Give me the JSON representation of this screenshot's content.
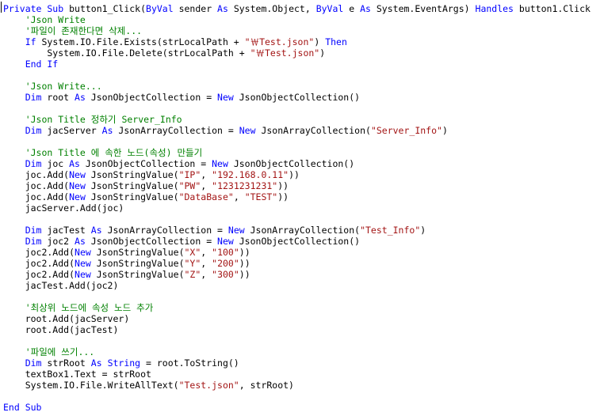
{
  "editor": {
    "colors": {
      "background": "#ffffff",
      "keyword": "#0000ff",
      "string": "#a31515",
      "comment": "#008000",
      "plain": "#000000"
    },
    "lines": [
      {
        "tokens": [
          [
            "kw",
            "Private Sub"
          ],
          [
            "plain",
            " button1_Click("
          ],
          [
            "kw",
            "ByVal"
          ],
          [
            "plain",
            " sender "
          ],
          [
            "kw",
            "As"
          ],
          [
            "plain",
            " System.Object, "
          ],
          [
            "kw",
            "ByVal"
          ],
          [
            "plain",
            " e "
          ],
          [
            "kw",
            "As"
          ],
          [
            "plain",
            " System.EventArgs) "
          ],
          [
            "kw",
            "Handles"
          ],
          [
            "plain",
            " button1.Click"
          ]
        ]
      },
      {
        "tokens": [
          [
            "cm",
            "    'Json Write"
          ]
        ]
      },
      {
        "tokens": [
          [
            "cm",
            "    '파일이 존재한다면 삭제..."
          ]
        ]
      },
      {
        "tokens": [
          [
            "kw",
            "    If"
          ],
          [
            "plain",
            " System.IO.File.Exists(strLocalPath + "
          ],
          [
            "str",
            "\"￦Test.json\""
          ],
          [
            "plain",
            ") "
          ],
          [
            "kw",
            "Then"
          ]
        ]
      },
      {
        "tokens": [
          [
            "plain",
            "        System.IO.File.Delete(strLocalPath + "
          ],
          [
            "str",
            "\"￦Test.json\""
          ],
          [
            "plain",
            ")"
          ]
        ]
      },
      {
        "tokens": [
          [
            "kw",
            "    End If"
          ]
        ]
      },
      {
        "tokens": []
      },
      {
        "tokens": [
          [
            "cm",
            "    'Json Write..."
          ]
        ]
      },
      {
        "tokens": [
          [
            "kw",
            "    Dim"
          ],
          [
            "plain",
            " root "
          ],
          [
            "kw",
            "As"
          ],
          [
            "plain",
            " JsonObjectCollection = "
          ],
          [
            "kw",
            "New"
          ],
          [
            "plain",
            " JsonObjectCollection()"
          ]
        ]
      },
      {
        "tokens": []
      },
      {
        "tokens": [
          [
            "cm",
            "    'Json Title 정하기 Server_Info"
          ]
        ]
      },
      {
        "tokens": [
          [
            "kw",
            "    Dim"
          ],
          [
            "plain",
            " jacServer "
          ],
          [
            "kw",
            "As"
          ],
          [
            "plain",
            " JsonArrayCollection = "
          ],
          [
            "kw",
            "New"
          ],
          [
            "plain",
            " JsonArrayCollection("
          ],
          [
            "str",
            "\"Server_Info\""
          ],
          [
            "plain",
            ")"
          ]
        ]
      },
      {
        "tokens": []
      },
      {
        "tokens": [
          [
            "cm",
            "    'Json Title 에 속한 노드(속성) 만들기"
          ]
        ]
      },
      {
        "tokens": [
          [
            "kw",
            "    Dim"
          ],
          [
            "plain",
            " joc "
          ],
          [
            "kw",
            "As"
          ],
          [
            "plain",
            " JsonObjectCollection = "
          ],
          [
            "kw",
            "New"
          ],
          [
            "plain",
            " JsonObjectCollection()"
          ]
        ]
      },
      {
        "tokens": [
          [
            "plain",
            "    joc.Add("
          ],
          [
            "kw",
            "New"
          ],
          [
            "plain",
            " JsonStringValue("
          ],
          [
            "str",
            "\"IP\""
          ],
          [
            "plain",
            ", "
          ],
          [
            "str",
            "\"192.168.0.11\""
          ],
          [
            "plain",
            "))"
          ]
        ]
      },
      {
        "tokens": [
          [
            "plain",
            "    joc.Add("
          ],
          [
            "kw",
            "New"
          ],
          [
            "plain",
            " JsonStringValue("
          ],
          [
            "str",
            "\"PW\""
          ],
          [
            "plain",
            ", "
          ],
          [
            "str",
            "\"1231231231\""
          ],
          [
            "plain",
            "))"
          ]
        ]
      },
      {
        "tokens": [
          [
            "plain",
            "    joc.Add("
          ],
          [
            "kw",
            "New"
          ],
          [
            "plain",
            " JsonStringValue("
          ],
          [
            "str",
            "\"DataBase\""
          ],
          [
            "plain",
            ", "
          ],
          [
            "str",
            "\"TEST\""
          ],
          [
            "plain",
            "))"
          ]
        ]
      },
      {
        "tokens": [
          [
            "plain",
            "    jacServer.Add(joc)"
          ]
        ]
      },
      {
        "tokens": []
      },
      {
        "tokens": [
          [
            "kw",
            "    Dim"
          ],
          [
            "plain",
            " jacTest "
          ],
          [
            "kw",
            "As"
          ],
          [
            "plain",
            " JsonArrayCollection = "
          ],
          [
            "kw",
            "New"
          ],
          [
            "plain",
            " JsonArrayCollection("
          ],
          [
            "str",
            "\"Test_Info\""
          ],
          [
            "plain",
            ")"
          ]
        ]
      },
      {
        "tokens": [
          [
            "kw",
            "    Dim"
          ],
          [
            "plain",
            " joc2 "
          ],
          [
            "kw",
            "As"
          ],
          [
            "plain",
            " JsonObjectCollection = "
          ],
          [
            "kw",
            "New"
          ],
          [
            "plain",
            " JsonObjectCollection()"
          ]
        ]
      },
      {
        "tokens": [
          [
            "plain",
            "    joc2.Add("
          ],
          [
            "kw",
            "New"
          ],
          [
            "plain",
            " JsonStringValue("
          ],
          [
            "str",
            "\"X\""
          ],
          [
            "plain",
            ", "
          ],
          [
            "str",
            "\"100\""
          ],
          [
            "plain",
            "))"
          ]
        ]
      },
      {
        "tokens": [
          [
            "plain",
            "    joc2.Add("
          ],
          [
            "kw",
            "New"
          ],
          [
            "plain",
            " JsonStringValue("
          ],
          [
            "str",
            "\"Y\""
          ],
          [
            "plain",
            ", "
          ],
          [
            "str",
            "\"200\""
          ],
          [
            "plain",
            "))"
          ]
        ]
      },
      {
        "tokens": [
          [
            "plain",
            "    joc2.Add("
          ],
          [
            "kw",
            "New"
          ],
          [
            "plain",
            " JsonStringValue("
          ],
          [
            "str",
            "\"Z\""
          ],
          [
            "plain",
            ", "
          ],
          [
            "str",
            "\"300\""
          ],
          [
            "plain",
            "))"
          ]
        ]
      },
      {
        "tokens": [
          [
            "plain",
            "    jacTest.Add(joc2)"
          ]
        ]
      },
      {
        "tokens": []
      },
      {
        "tokens": [
          [
            "cm",
            "    '최상위 노드에 속성 노드 추가"
          ]
        ]
      },
      {
        "tokens": [
          [
            "plain",
            "    root.Add(jacServer)"
          ]
        ]
      },
      {
        "tokens": [
          [
            "plain",
            "    root.Add(jacTest)"
          ]
        ]
      },
      {
        "tokens": []
      },
      {
        "tokens": [
          [
            "cm",
            "    '파일에 쓰기..."
          ]
        ]
      },
      {
        "tokens": [
          [
            "kw",
            "    Dim"
          ],
          [
            "plain",
            " strRoot "
          ],
          [
            "kw",
            "As"
          ],
          [
            "kw",
            " String"
          ],
          [
            "plain",
            " = root.ToString()"
          ]
        ]
      },
      {
        "tokens": [
          [
            "plain",
            "    textBox1.Text = strRoot"
          ]
        ]
      },
      {
        "tokens": [
          [
            "plain",
            "    System.IO.File.WriteAllText("
          ],
          [
            "str",
            "\"Test.json\""
          ],
          [
            "plain",
            ", strRoot)"
          ]
        ]
      },
      {
        "tokens": []
      },
      {
        "tokens": [
          [
            "kw",
            "End Sub"
          ]
        ]
      }
    ]
  }
}
